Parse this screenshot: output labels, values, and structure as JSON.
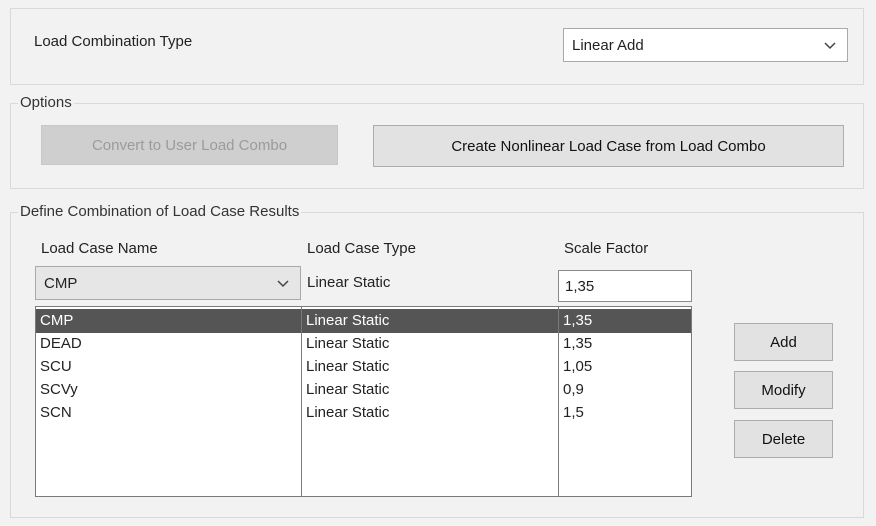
{
  "load_combination_type": {
    "label": "Load Combination Type",
    "selected": "Linear Add"
  },
  "options": {
    "title": "Options",
    "convert_button": "Convert to User Load Combo",
    "create_button": "Create Nonlinear Load Case from Load Combo"
  },
  "define": {
    "title": "Define Combination of Load Case Results",
    "headers": {
      "name": "Load Case Name",
      "type": "Load Case Type",
      "factor": "Scale Factor"
    },
    "editor": {
      "name": "CMP",
      "type": "Linear Static",
      "factor": "1,35"
    },
    "rows": [
      {
        "name": "CMP",
        "type": "Linear Static",
        "factor": "1,35"
      },
      {
        "name": "DEAD",
        "type": "Linear Static",
        "factor": "1,35"
      },
      {
        "name": "SCU",
        "type": "Linear Static",
        "factor": "1,05"
      },
      {
        "name": "SCVy",
        "type": "Linear Static",
        "factor": "0,9"
      },
      {
        "name": "SCN",
        "type": "Linear Static",
        "factor": "1,5"
      }
    ],
    "selected_row": 0,
    "buttons": {
      "add": "Add",
      "modify": "Modify",
      "delete": "Delete"
    }
  }
}
